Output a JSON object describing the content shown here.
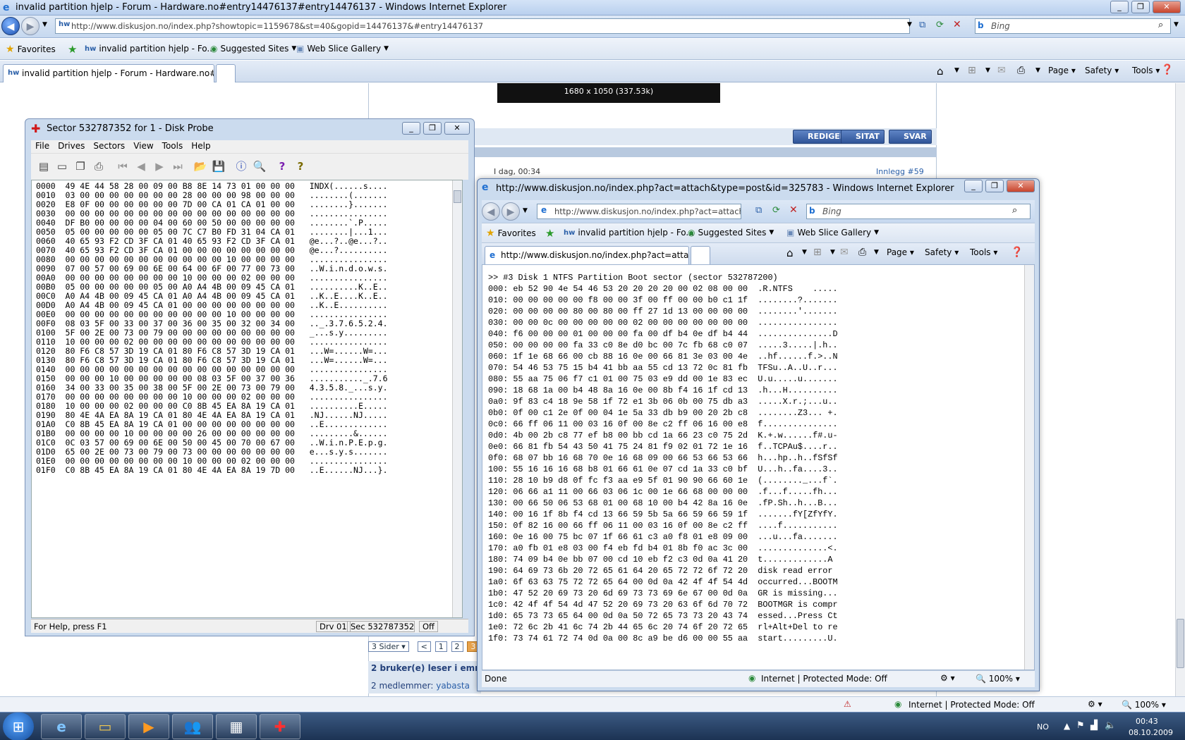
{
  "main_window": {
    "title": "invalid partition hjelp - Forum - Hardware.no#entry14476137#entry14476137 - Windows Internet Explorer",
    "address": "http://www.diskusjon.no/index.php?showtopic=1159678&st=40&gopid=14476137&#entry14476137",
    "search_placeholder": "Bing",
    "favorites_label": "Favorites",
    "fav_items": [
      "invalid partition hjelp - Fo...",
      "Suggested Sites",
      "Web Slice Gallery"
    ],
    "tab_label": "invalid partition hjelp - Forum - Hardware.no#en...",
    "commands": [
      "Page",
      "Safety",
      "Tools"
    ],
    "status_zone": "Internet | Protected Mode: Off",
    "zoom": "100%"
  },
  "forum": {
    "image_caption": "1680 x 1050 (337.53k)",
    "buttons": [
      "REDIGER",
      "SITAT",
      "SVAR"
    ],
    "post_time": "I dag, 00:34",
    "post_number": "Innlegg #59",
    "pager": {
      "label": "3 Sider",
      "prev": "<",
      "pages": [
        "1",
        "2",
        "3"
      ],
      "current": "3"
    },
    "readers": "2 bruker(e) leser i emn",
    "members_label": "2 medlemmer:",
    "member_name": "yabasta"
  },
  "diskprobe": {
    "title": "Sector 532787352 for 1 - Disk Probe",
    "menu": [
      "File",
      "Drives",
      "Sectors",
      "View",
      "Tools",
      "Help"
    ],
    "status": {
      "help": "For Help, press F1",
      "drive": "Drv 01",
      "sector": "Sec 532787352",
      "mode": "Off"
    },
    "rows": [
      "0000  49 4E 44 58 28 00 09 00 B8 8E 14 73 01 00 00 00   INDX(......s....",
      "0010  03 00 00 00 00 00 00 00 28 00 00 00 98 00 00 00   ........(.......",
      "0020  E8 0F 00 00 00 00 00 00 7D 00 CA 01 CA 01 00 00   ........}.......",
      "0030  00 00 00 00 00 00 00 00 00 00 00 00 00 00 00 00   ................",
      "0040  DF B0 00 00 00 00 04 00 60 00 50 00 00 00 00 00   ........`.P.....",
      "0050  05 00 00 00 00 00 05 00 7C C7 B0 FD 31 04 CA 01   ........|...1...",
      "0060  40 65 93 F2 CD 3F CA 01 40 65 93 F2 CD 3F CA 01   @e...?..@e...?..",
      "0070  40 65 93 F2 CD 3F CA 01 00 00 00 00 00 00 00 00   @e...?..........",
      "0080  00 00 00 00 00 00 00 00 00 00 00 10 00 00 00 00   ................",
      "0090  07 00 57 00 69 00 6E 00 64 00 6F 00 77 00 73 00   ..W.i.n.d.o.w.s.",
      "00A0  00 00 00 00 00 00 00 00 10 00 00 00 02 00 00 00   ................",
      "00B0  05 00 00 00 00 00 05 00 A0 A4 4B 00 09 45 CA 01   ..........K..E..",
      "00C0  A0 A4 4B 00 09 45 CA 01 A0 A4 4B 00 09 45 CA 01   ..K..E....K..E..",
      "00D0  A0 A4 4B 00 09 45 CA 01 00 00 00 00 00 00 00 00   ..K..E..........",
      "00E0  00 00 00 00 00 00 00 00 00 00 00 10 00 00 00 00   ................",
      "00F0  08 03 5F 00 33 00 37 00 36 00 35 00 32 00 34 00   .._.3.7.6.5.2.4.",
      "0100  5F 00 2E 00 73 00 79 00 00 00 00 00 00 00 00 00   _...s.y.........",
      "0110  10 00 00 00 02 00 00 00 00 00 00 00 00 00 00 00   ................",
      "0120  80 F6 C8 57 3D 19 CA 01 80 F6 C8 57 3D 19 CA 01   ...W=......W=...",
      "0130  80 F6 C8 57 3D 19 CA 01 80 F6 C8 57 3D 19 CA 01   ...W=......W=...",
      "0140  00 00 00 00 00 00 00 00 00 00 00 00 00 00 00 00   ................",
      "0150  00 00 00 10 00 00 00 00 00 08 03 5F 00 37 00 36   ..........._.7.6",
      "0160  34 00 33 00 35 00 38 00 5F 00 2E 00 73 00 79 00   4.3.5.8._...s.y.",
      "0170  00 00 00 00 00 00 00 00 10 00 00 00 02 00 00 00   ................",
      "0180  10 00 00 00 02 00 00 00 C0 8B 45 EA 8A 19 CA 01   ..........E.....",
      "0190  80 4E 4A EA 8A 19 CA 01 80 4E 4A EA 8A 19 CA 01   .NJ......NJ.....",
      "01A0  C0 8B 45 EA 8A 19 CA 01 00 00 00 00 00 00 00 00   ..E.............",
      "01B0  00 00 00 00 10 00 00 00 00 26 00 00 00 00 00 00   .........&......",
      "01C0  0C 03 57 00 69 00 6E 00 50 00 45 00 70 00 67 00   ..W.i.n.P.E.p.g.",
      "01D0  65 00 2E 00 73 00 79 00 73 00 00 00 00 00 00 00   e...s.y.s.......",
      "01E0  00 00 00 00 00 00 00 00 10 00 00 00 02 00 00 00   ................",
      "01F0  C0 8B 45 EA 8A 19 CA 01 80 4E 4A EA 8A 19 7D 00   ..E......NJ...}."
    ]
  },
  "popup": {
    "title": "http://www.diskusjon.no/index.php?act=attach&type=post&id=325783 - Windows Internet Explorer",
    "address": "http://www.diskusjon.no/index.php?act=attach&ty",
    "search_placeholder": "Bing",
    "favorites_label": "Favorites",
    "fav_items": [
      "invalid partition hjelp - Fo...",
      "Suggested Sites",
      "Web Slice Gallery"
    ],
    "tab_label": "http://www.diskusjon.no/index.php?act=attach...",
    "commands": [
      "Page",
      "Safety",
      "Tools"
    ],
    "status_done": "Done",
    "status_zone": "Internet | Protected Mode: Off",
    "zoom": "100%",
    "header": ">> #3 Disk 1 NTFS Partition Boot sector (sector 532787200)",
    "lines": [
      "000: eb 52 90 4e 54 46 53 20 20 20 20 00 02 08 00 00  .R.NTFS    .....",
      "010: 00 00 00 00 00 f8 00 00 3f 00 ff 00 00 b0 c1 1f  ........?.......",
      "020: 00 00 00 00 80 00 80 00 ff 27 1d 13 00 00 00 00  ........'.......",
      "030: 00 00 0c 00 00 00 00 00 02 00 00 00 00 00 00 00  ................",
      "040: f6 00 00 00 01 00 00 00 fa 00 df b4 0e df b4 44  ...............D",
      "050: 00 00 00 00 fa 33 c0 8e d0 bc 00 7c fb 68 c0 07  .....3.....|.h..",
      "060: 1f 1e 68 66 00 cb 88 16 0e 00 66 81 3e 03 00 4e  ..hf......f.>..N",
      "070: 54 46 53 75 15 b4 41 bb aa 55 cd 13 72 0c 81 fb  TFSu..A..U..r...",
      "080: 55 aa 75 06 f7 c1 01 00 75 03 e9 dd 00 1e 83 ec  U.u.....u.......",
      "090: 18 68 1a 00 b4 48 8a 16 0e 00 8b f4 16 1f cd 13  .h...H..........",
      "0a0: 9f 83 c4 18 9e 58 1f 72 e1 3b 06 0b 00 75 db a3  .....X.r.;...u..",
      "0b0: 0f 00 c1 2e 0f 00 04 1e 5a 33 db b9 00 20 2b c8  ........Z3... +.",
      "0c0: 66 ff 06 11 00 03 16 0f 00 8e c2 ff 06 16 00 e8  f...............",
      "0d0: 4b 00 2b c8 77 ef b8 00 bb cd 1a 66 23 c0 75 2d  K.+.w......f#.u-",
      "0e0: 66 81 fb 54 43 50 41 75 24 81 f9 02 01 72 1e 16  f..TCPAu$....r..",
      "0f0: 68 07 bb 16 68 70 0e 16 68 09 00 66 53 66 53 66  h...hp..h..fSfSf",
      "100: 55 16 16 16 68 b8 01 66 61 0e 07 cd 1a 33 c0 bf  U...h..fa....3..",
      "110: 28 10 b9 d8 0f fc f3 aa e9 5f 01 90 90 66 60 1e  (........_...f`.",
      "120: 06 66 a1 11 00 66 03 06 1c 00 1e 66 68 00 00 00  .f...f.....fh...",
      "130: 00 66 50 06 53 68 01 00 68 10 00 b4 42 8a 16 0e  .fP.Sh..h...B...",
      "140: 00 16 1f 8b f4 cd 13 66 59 5b 5a 66 59 66 59 1f  .......fY[ZfYfY.",
      "150: 0f 82 16 00 66 ff 06 11 00 03 16 0f 00 8e c2 ff  ....f...........",
      "160: 0e 16 00 75 bc 07 1f 66 61 c3 a0 f8 01 e8 09 00  ...u...fa.......",
      "170: a0 fb 01 e8 03 00 f4 eb fd b4 01 8b f0 ac 3c 00  ..............<.",
      "180: 74 09 b4 0e bb 07 00 cd 10 eb f2 c3 0d 0a 41 20  t.............A ",
      "190: 64 69 73 6b 20 72 65 61 64 20 65 72 72 6f 72 20  disk read error ",
      "1a0: 6f 63 63 75 72 72 65 64 00 0d 0a 42 4f 4f 54 4d  occurred...BOOTM",
      "1b0: 47 52 20 69 73 20 6d 69 73 73 69 6e 67 00 0d 0a  GR is missing...",
      "1c0: 42 4f 4f 54 4d 47 52 20 69 73 20 63 6f 6d 70 72  BOOTMGR is compr",
      "1d0: 65 73 73 65 64 00 0d 0a 50 72 65 73 73 20 43 74  essed...Press Ct",
      "1e0: 72 6c 2b 41 6c 74 2b 44 65 6c 20 74 6f 20 72 65  rl+Alt+Del to re",
      "1f0: 73 74 61 72 74 0d 0a 00 8c a9 be d6 00 00 55 aa  start.........U."
    ]
  },
  "taskbar": {
    "lang": "NO",
    "time": "00:43",
    "date": "08.10.2009"
  },
  "colors": {
    "accent": "#2f5498",
    "page_border": "#b7c6d8",
    "pager_current": "#e8a24a"
  }
}
